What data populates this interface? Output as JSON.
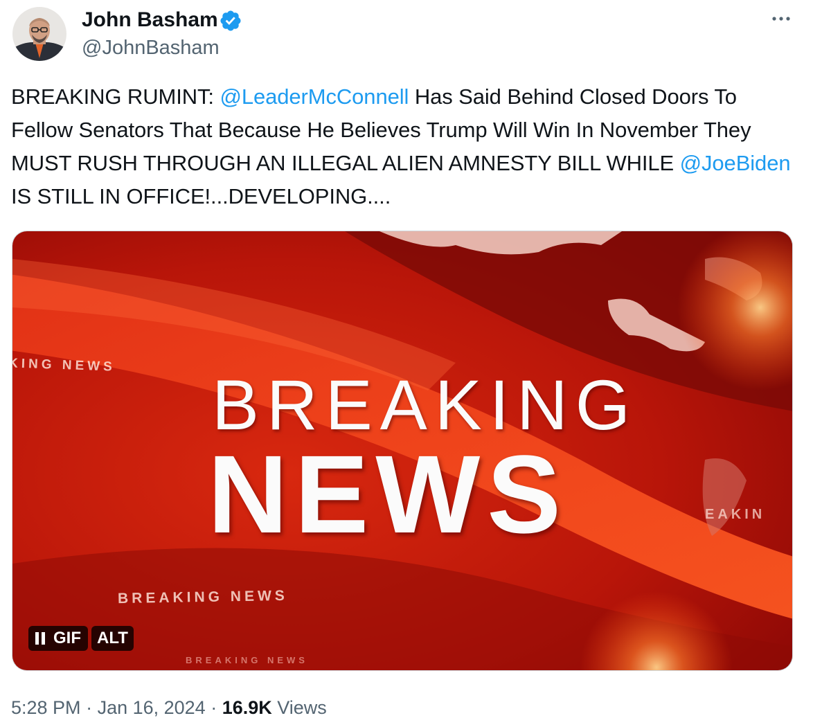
{
  "author": {
    "display_name": "John Basham",
    "handle": "@JohnBasham",
    "verified_icon": "verified-badge-icon",
    "avatar_icon": "user-avatar"
  },
  "menu": {
    "more_icon": "more-dots-icon"
  },
  "tweet": {
    "text_1": "BREAKING RUMINT: ",
    "mention_1": "@LeaderMcConnell",
    "text_2": " Has Said Behind Closed Doors To Fellow Senators That Because He Believes Trump Will Win In November They MUST RUSH THROUGH AN ILLEGAL ALIEN AMNESTY BILL WHILE ",
    "mention_2": "@JoeBiden",
    "text_3": " IS STILL IN OFFICE!...DEVELOPING...."
  },
  "media": {
    "headline_line1": "BREAKING",
    "headline_line2": "NEWS",
    "ticker_top_left": "KING NEWS",
    "ticker_bottom": "BREAKING NEWS",
    "ticker_very_bottom": "BREAKING NEWS",
    "ticker_right": "EAKIN",
    "gif_label": "GIF",
    "alt_label": "ALT",
    "pause_icon": "pause-icon"
  },
  "meta": {
    "time": "5:28 PM",
    "separator": " · ",
    "date": "Jan 16, 2024",
    "views_count": "16.9K",
    "views_label": " Views"
  },
  "colors": {
    "link": "#1d9bf0",
    "verified": "#1d9bf0",
    "secondary_text": "#536471",
    "media_red": "#c41b0f"
  }
}
